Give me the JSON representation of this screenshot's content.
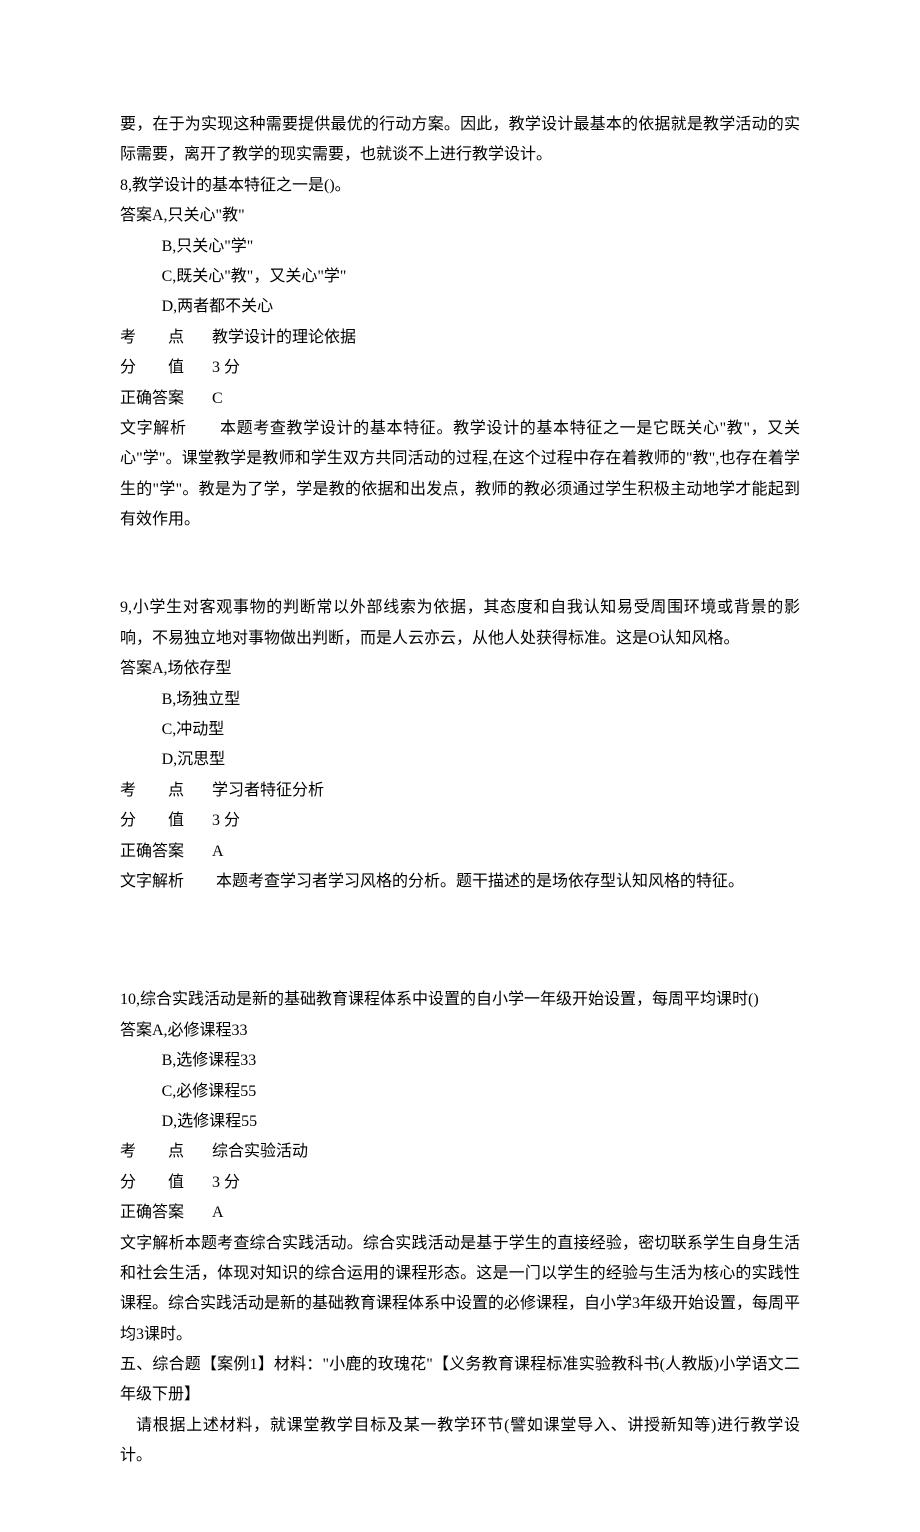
{
  "intro": "要，在于为实现这种需要提供最优的行动方案。因此，教学设计最基本的依据就是教学活动的实际需要，离开了教学的现实需要，也就谈不上进行教学设计。",
  "q8": {
    "stem": "8,教学设计的基本特征之一是()。",
    "a": "答案A,只关心\"教\"",
    "b": "B,只关心\"学\"",
    "c": "C,既关心\"教\"，又关心\"学\"",
    "d": "D,两者都不关心",
    "kaodian_label": "考　　点",
    "kaodian": "教学设计的理论依据",
    "fenzhi_label": "分　　值",
    "fenzhi": "3 分",
    "zhengque_label": "正确答案",
    "zhengque": "C",
    "jiexi_label": "文字解析",
    "jiexi": "本题考查教学设计的基本特征。教学设计的基本特征之一是它既关心\"教\"，又关心\"学\"。课堂教学是教师和学生双方共同活动的过程,在这个过程中存在着教师的\"教\",也存在着学生的\"学\"。教是为了学，学是教的依据和出发点，教师的教必须通过学生积极主动地学才能起到有效作用。"
  },
  "q9": {
    "stem": "9,小学生对客观事物的判断常以外部线索为依据，其态度和自我认知易受周围环境或背景的影响，不易独立地对事物做出判断，而是人云亦云，从他人处获得标准。这是O认知风格。",
    "a": "答案A,场依存型",
    "b": "B,场独立型",
    "c": "C,冲动型",
    "d": "D,沉思型",
    "kaodian_label": "考　　点",
    "kaodian": "学习者特征分析",
    "fenzhi_label": "分　　值",
    "fenzhi": "3 分",
    "zhengque_label": "正确答案",
    "zhengque": "A",
    "jiexi_label": "文字解析",
    "jiexi": "本题考查学习者学习风格的分析。题干描述的是场依存型认知风格的特征。"
  },
  "q10": {
    "stem": "10,综合实践活动是新的基础教育课程体系中设置的自小学一年级开始设置，每周平均课时()",
    "a": "答案A,必修课程33",
    "b": "B,选修课程33",
    "c": "C,必修课程55",
    "d": "D,选修课程55",
    "kaodian_label": "考　　点",
    "kaodian": "综合实验活动",
    "fenzhi_label": "分　　值",
    "fenzhi": "3 分",
    "zhengque_label": "正确答案",
    "zhengque": "A",
    "jiexi": "文字解析本题考查综合实践活动。综合实践活动是基于学生的直接经验，密切联系学生自身生活和社会生活，体现对知识的综合运用的课程形态。这是一门以学生的经验与生活为核心的实践性课程。综合实践活动是新的基础教育课程体系中设置的必修课程，自小学3年级开始设置，每周平均3课时。"
  },
  "section5": {
    "p1": "五、综合题【案例1】材料：\"小鹿的玫瑰花\"【义务教育课程标准实验教科书(人教版)小学语文二年级下册】",
    "p2": "请根据上述材料，就课堂教学目标及某一教学环节(譬如课堂导入、讲授新知等)进行教学设计。"
  }
}
